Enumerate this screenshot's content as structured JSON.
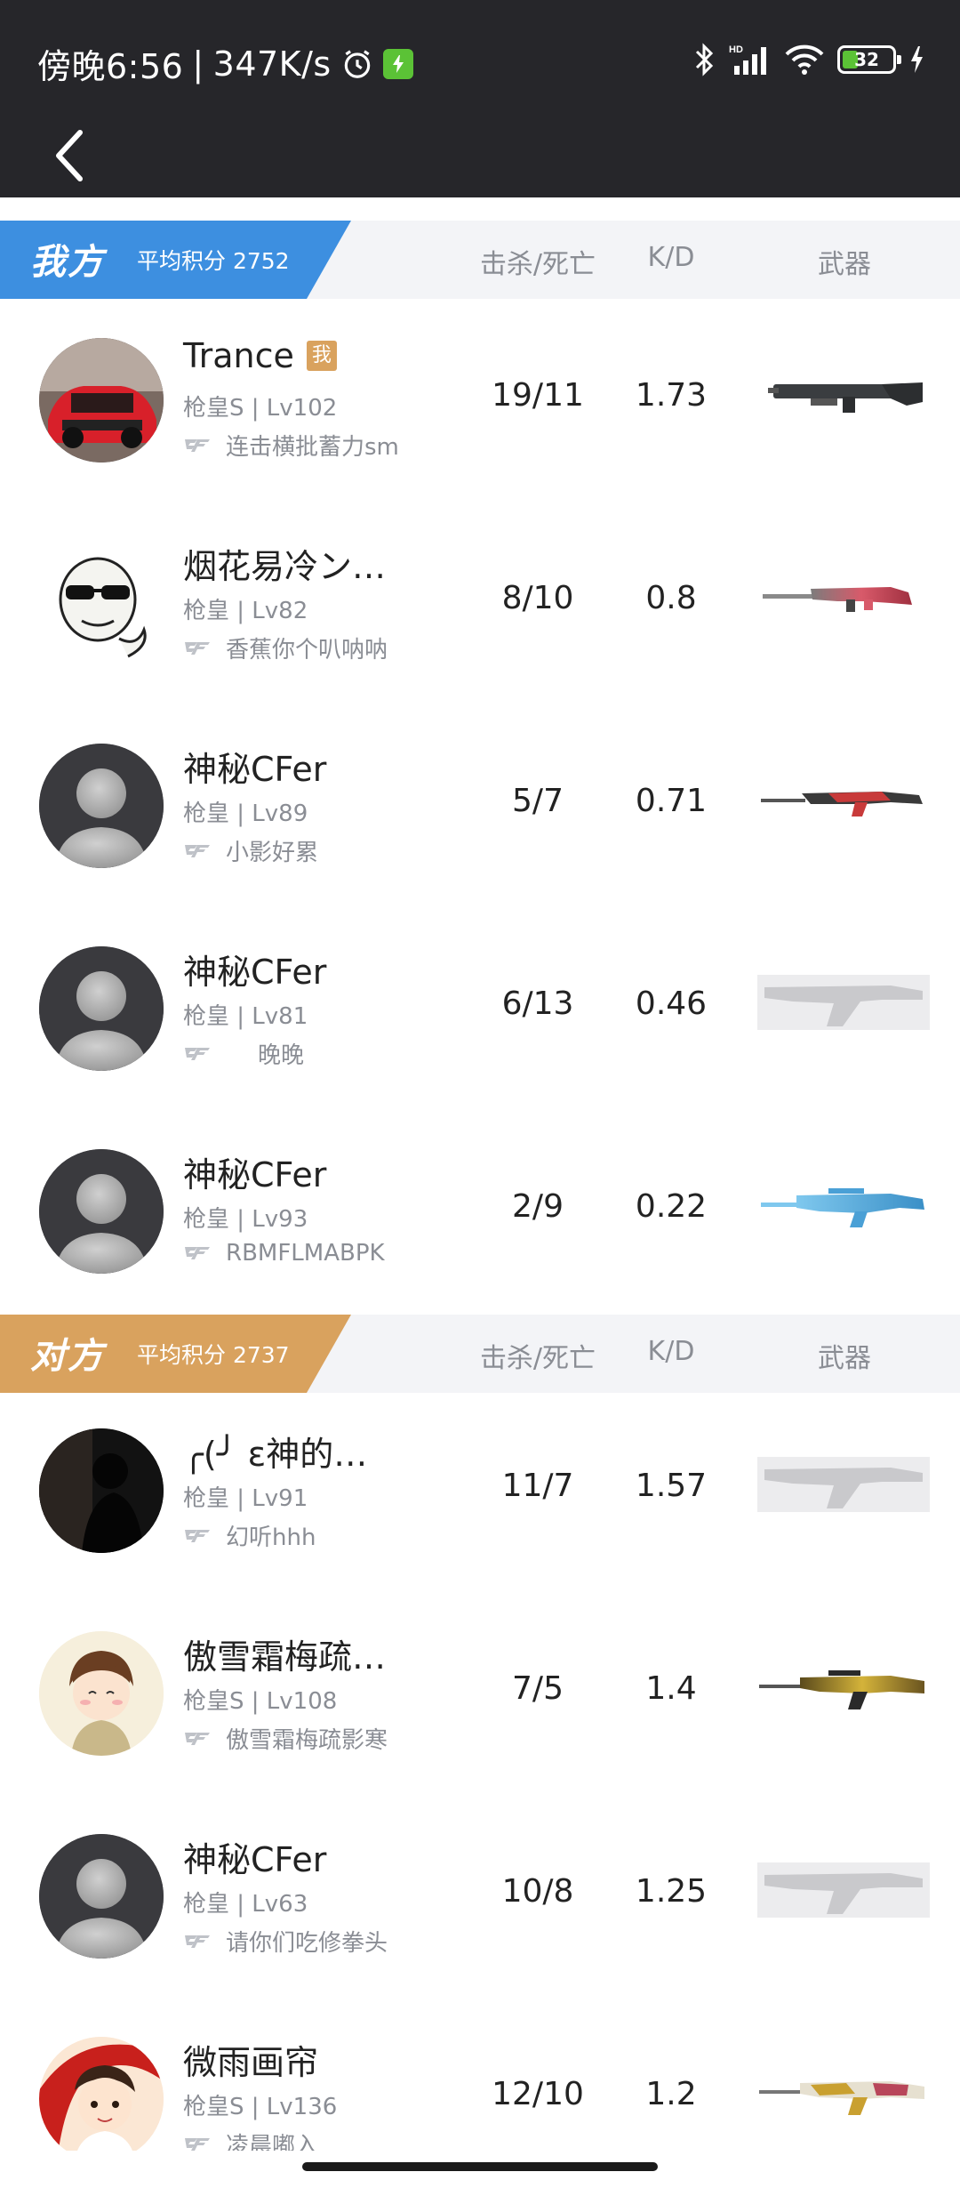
{
  "status": {
    "time": "傍晚6:56",
    "speed": "347K/s",
    "battery": "32",
    "battery_level": 0.32
  },
  "colors": {
    "ally": "#3d8fe0",
    "enemy": "#d9a25e",
    "header_bg": "#f3f4f7"
  },
  "columns": {
    "kd": "击杀/死亡",
    "ratio": "K/D",
    "weapon": "武器"
  },
  "ally": {
    "team_name": "我方",
    "avg_label": "平均积分 2752",
    "players": [
      {
        "name": "Trance",
        "badge": "我",
        "rank": "枪皇S | Lv102",
        "motto": "连击横批蓄力sm",
        "kd": "19/11",
        "ratio": "1.73",
        "avatar": "car-avatar",
        "weapon": "shotgun-dark"
      },
      {
        "name": "烟花易冷ン…",
        "rank": "枪皇 | Lv82",
        "motto": "香蕉你个叭呐呐",
        "kd": "8/10",
        "ratio": "0.8",
        "avatar": "meme-face-avatar",
        "weapon": "rifle-red"
      },
      {
        "name": "神秘CFer",
        "rank": "枪皇 | Lv89",
        "motto": "小影好累",
        "kd": "5/7",
        "ratio": "0.71",
        "avatar": "default-avatar",
        "weapon": "ak-red"
      },
      {
        "name": "神秘CFer",
        "rank": "枪皇 | Lv81",
        "motto": "晚晚",
        "kd": "6/13",
        "ratio": "0.46",
        "avatar": "default-avatar",
        "weapon": "ak-placeholder"
      },
      {
        "name": "神秘CFer",
        "rank": "枪皇 | Lv93",
        "motto": "RBMFLMABPK",
        "kd": "2/9",
        "ratio": "0.22",
        "avatar": "default-avatar",
        "weapon": "rifle-blue"
      }
    ]
  },
  "enemy": {
    "team_name": "对方",
    "avg_label": "平均积分 2737",
    "players": [
      {
        "name": "╭(╯ ε神的…",
        "rank": "枪皇 | Lv91",
        "motto": "幻听hhh",
        "kd": "11/7",
        "ratio": "1.57",
        "avatar": "dark-photo-avatar",
        "weapon": "ak-placeholder"
      },
      {
        "name": "傲雪霜梅疏…",
        "rank": "枪皇S | Lv108",
        "motto": "傲雪霜梅疏影寒",
        "kd": "7/5",
        "ratio": "1.4",
        "avatar": "cartoon-boy-avatar",
        "weapon": "rifle-gold"
      },
      {
        "name": "神秘CFer",
        "rank": "枪皇 | Lv63",
        "motto": "请你们吃修拳头",
        "kd": "10/8",
        "ratio": "1.25",
        "avatar": "default-avatar",
        "weapon": "ak-placeholder"
      },
      {
        "name": "微雨画帘",
        "rank": "枪皇S | Lv136",
        "motto": "凌晨嘟入",
        "kd": "12/10",
        "ratio": "1.2",
        "avatar": "cartoon-girl-avatar",
        "weapon": "rifle-gold-ornate"
      }
    ]
  }
}
